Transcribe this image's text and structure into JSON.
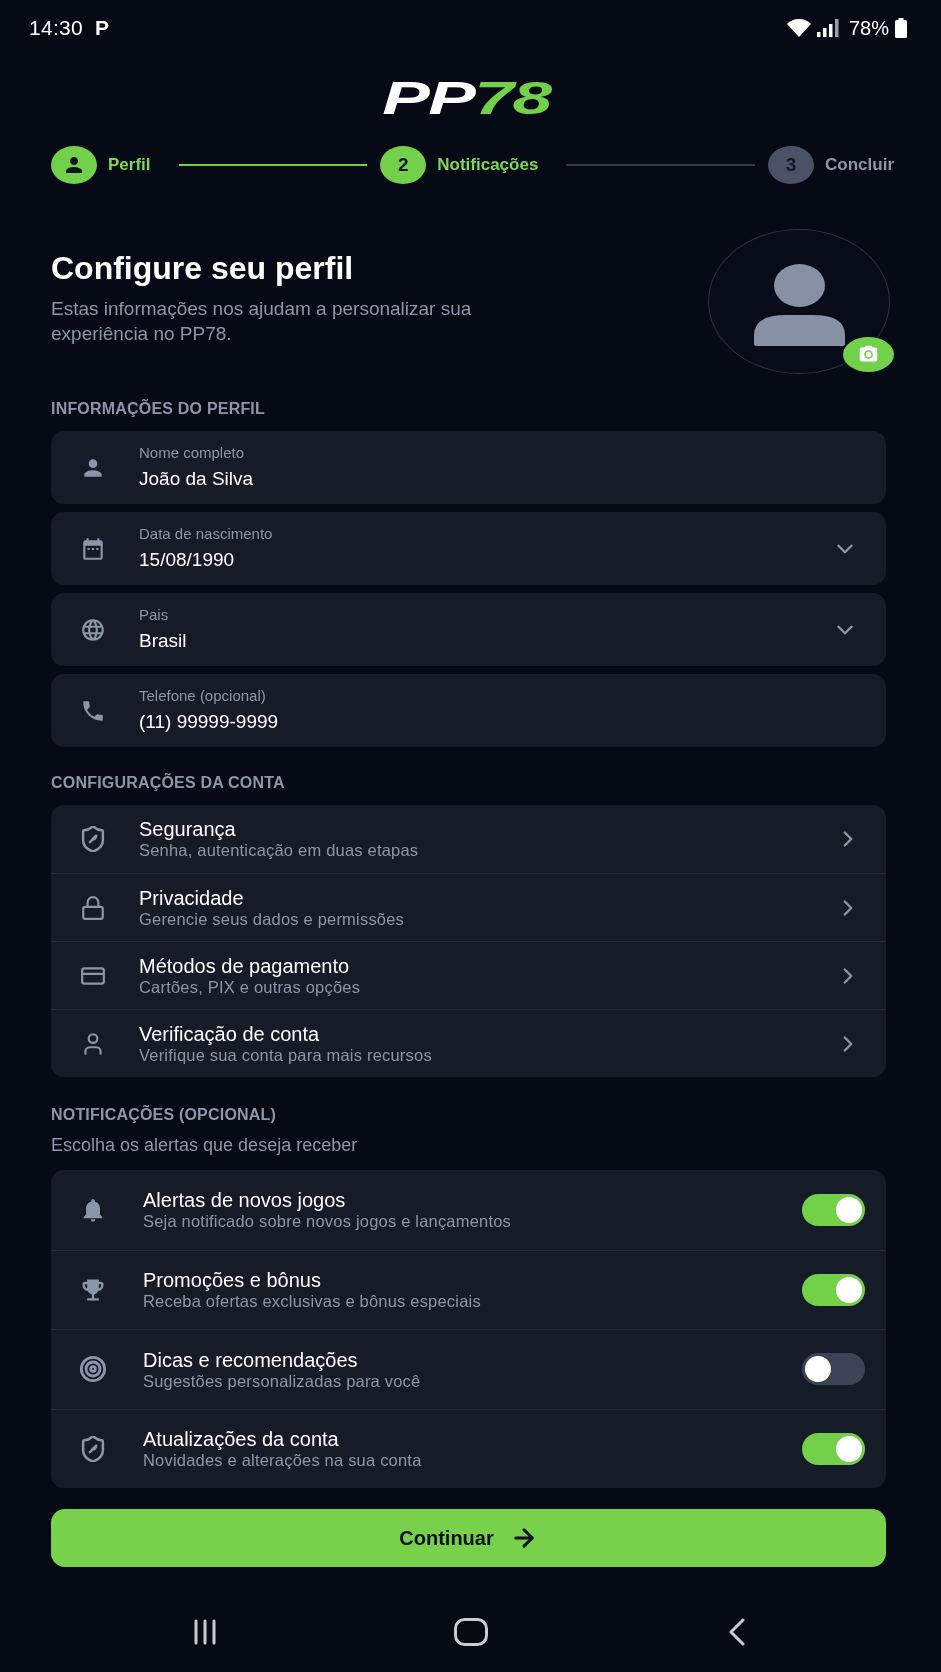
{
  "status_bar": {
    "time": "14:30",
    "notification": "P",
    "battery": "78%"
  },
  "logo": {
    "text": "PP",
    "accent": "78"
  },
  "stepper": [
    {
      "label": "Perfil",
      "active": true
    },
    {
      "number": "2",
      "label": "Notificações",
      "active": true
    },
    {
      "number": "3",
      "label": "Concluir",
      "active": false
    }
  ],
  "header": {
    "title": "Configure seu perfil",
    "subtitle": "Estas informações nos ajudam a personalizar sua experiência no PP78."
  },
  "profile_section": {
    "heading": "INFORMAÇÕES DO PERFIL",
    "fields": [
      {
        "kind": "text",
        "label": "Nome completo",
        "value": "João da Silva"
      },
      {
        "kind": "select",
        "label": "Data de nascimento",
        "value": "15/08/1990"
      },
      {
        "kind": "select",
        "label": "Pais",
        "value": "Brasil"
      },
      {
        "kind": "text",
        "label": "Telefone (opcional)",
        "value": "(11) 99999-9999"
      }
    ]
  },
  "account_section": {
    "heading": "CONFIGURAÇÕES DA CONTA",
    "items": [
      {
        "title": "Segurança",
        "subtitle": "Senha, autenticação em duas etapas"
      },
      {
        "title": "Privacidade",
        "subtitle": "Gerencie seus dados e permissões"
      },
      {
        "title": "Métodos de pagamento",
        "subtitle": "Cartões, PIX e outras opções"
      },
      {
        "title": "Verificação de conta",
        "subtitle": "Verifique sua conta para mais recursos"
      }
    ]
  },
  "notifications_section": {
    "heading": "NOTIFICAÇÕES (OPCIONAL)",
    "description": "Escolha os alertas que deseja receber",
    "items": [
      {
        "title": "Alertas de novos jogos",
        "subtitle": "Seja notificado sobre novos jogos e lançamentos",
        "on": true
      },
      {
        "title": "Promoções e bônus",
        "subtitle": "Receba ofertas exclusivas e bônus especiais",
        "on": true
      },
      {
        "title": "Dicas e recomendações",
        "subtitle": "Sugestões personalizadas para você",
        "on": false
      },
      {
        "title": "Atualizações da conta",
        "subtitle": "Novidades e alterações na sua conta",
        "on": true
      }
    ]
  },
  "primary_button": {
    "label": "Continuar"
  }
}
